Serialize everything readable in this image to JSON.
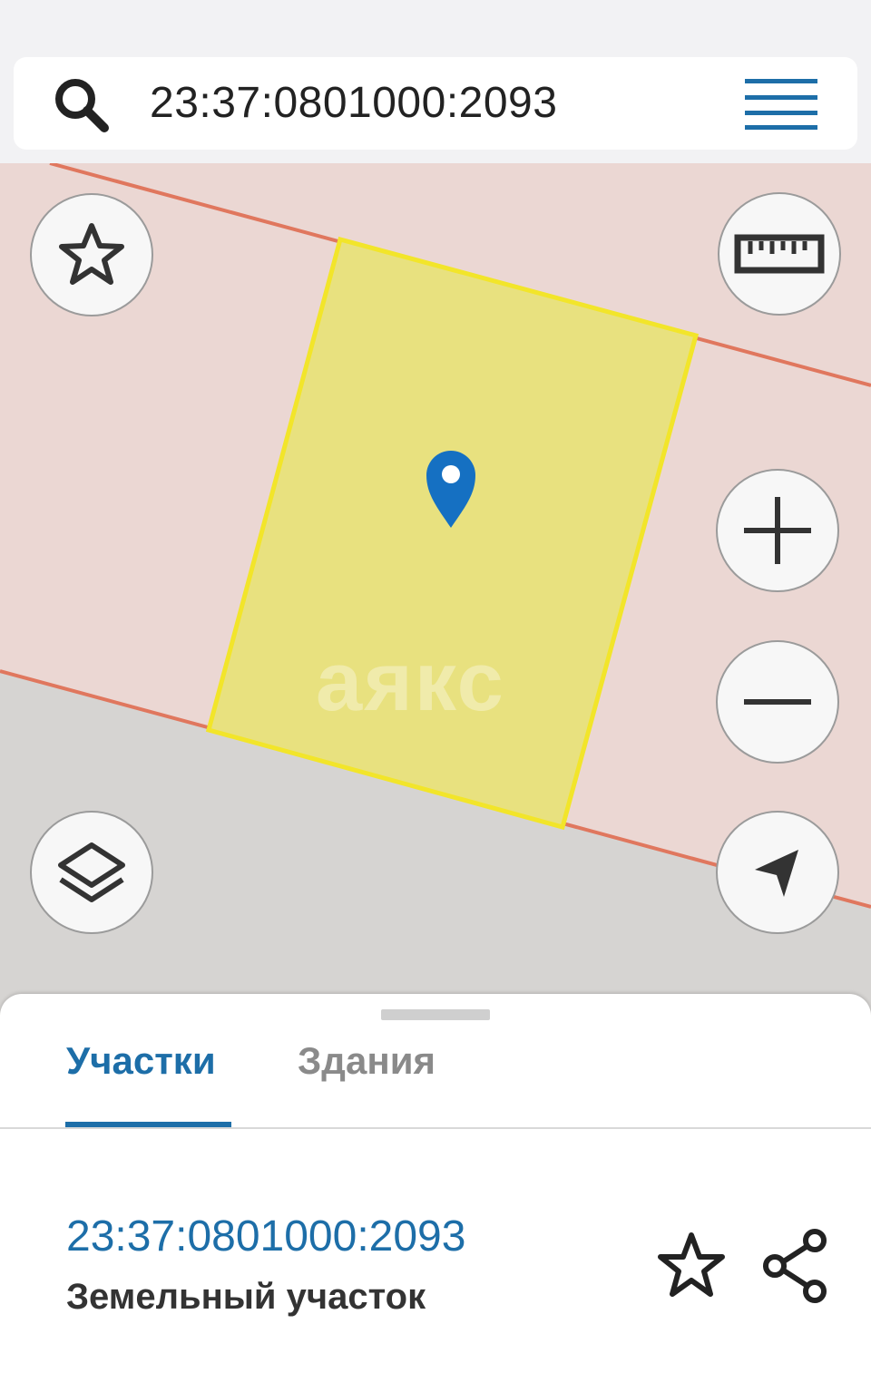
{
  "search": {
    "query": "23:37:0801000:2093",
    "icon": "search-icon",
    "menu_icon": "menu-icon"
  },
  "map": {
    "watermark": "аякс",
    "controls": {
      "favorite_icon": "star-icon",
      "ruler_icon": "ruler-icon",
      "zoom_in_icon": "plus-icon",
      "zoom_out_icon": "minus-icon",
      "layers_icon": "layers-icon",
      "locate_icon": "navigation-arrow-icon"
    },
    "colors": {
      "land": "#ebd7d3",
      "road": "#d6d4d2",
      "parcel_fill": "#e8e17f",
      "parcel_border": "#f2e52a",
      "boundary": "#e0775e",
      "marker": "#1570c2"
    }
  },
  "sheet": {
    "tabs": [
      {
        "label": "Участки",
        "active": true
      },
      {
        "label": "Здания",
        "active": false
      }
    ],
    "result": {
      "number": "23:37:0801000:2093",
      "type": "Земельный участок"
    }
  },
  "colors": {
    "accent": "#1d6ea8"
  }
}
